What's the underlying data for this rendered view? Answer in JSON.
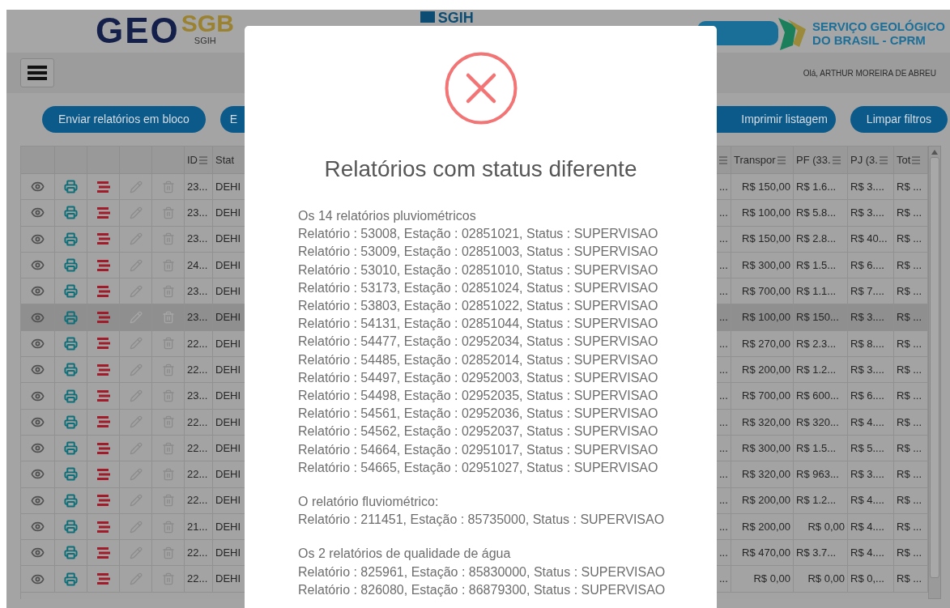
{
  "header": {
    "logo_left": {
      "word": "GEO",
      "brand": "SGB",
      "system": "SGIH"
    },
    "logo_center": "SGIH",
    "agency": [
      "SERVIÇO GEOLÓGICO",
      "DO BRASIL - CPRM"
    ]
  },
  "nav": {
    "greeting": "Olá, ARTHUR MOREIRA DE ABREU"
  },
  "actions": [
    {
      "label": "Enviar relatórios em bloco"
    },
    {
      "label": "E"
    },
    {
      "label": "Imprimir listagem"
    },
    {
      "label": "Limpar filtros"
    }
  ],
  "table": {
    "columns": [
      "ID",
      "Stat",
      "Transpor",
      "PF (33.",
      "PJ (3.",
      "Tot"
    ],
    "rows": [
      {
        "id": "23...",
        "status": "DEHI",
        "column_8": "...",
        "transporte": "R$ 150,00",
        "pf": "R$ 1.6...",
        "pj": "R$ 3....",
        "total": "R$ ...",
        "selected": false
      },
      {
        "id": "23...",
        "status": "DEHI",
        "column_8": "...",
        "transporte": "R$ 100,00",
        "pf": "R$ 5.8...",
        "pj": "R$ 3....",
        "total": "R$ ...",
        "selected": false
      },
      {
        "id": "23...",
        "status": "DEHI",
        "column_8": "...",
        "transporte": "R$ 150,00",
        "pf": "R$ 2.8...",
        "pj": "R$ 40...",
        "total": "R$ ...",
        "selected": false
      },
      {
        "id": "24...",
        "status": "DEHI",
        "column_8": "...",
        "transporte": "R$ 300,00",
        "pf": "R$ 1.5...",
        "pj": "R$ 6....",
        "total": "R$ ...",
        "selected": false
      },
      {
        "id": "23...",
        "status": "DEHI",
        "column_8": "...",
        "transporte": "R$ 700,00",
        "pf": "R$ 1.1...",
        "pj": "R$ 7....",
        "total": "R$ ...",
        "selected": false
      },
      {
        "id": "23...",
        "status": "DEHI",
        "column_8": "...",
        "transporte": "R$ 100,00",
        "pf": "R$ 150...",
        "pj": "R$ 3....",
        "total": "R$ ...",
        "selected": true
      },
      {
        "id": "22...",
        "status": "DEHI",
        "column_8": "...",
        "transporte": "R$ 270,00",
        "pf": "R$ 2.3...",
        "pj": "R$ 8....",
        "total": "R$ ...",
        "selected": false
      },
      {
        "id": "22...",
        "status": "DEHI",
        "column_8": "...",
        "transporte": "R$ 200,00",
        "pf": "R$ 1.2...",
        "pj": "R$ 3....",
        "total": "R$ ...",
        "selected": false
      },
      {
        "id": "23...",
        "status": "DEHI",
        "column_8": "...",
        "transporte": "R$ 700,00",
        "pf": "R$ 600...",
        "pj": "R$ 6....",
        "total": "R$ ...",
        "selected": false
      },
      {
        "id": "22...",
        "status": "DEHI",
        "column_8": "...",
        "transporte": "R$ 320,00",
        "pf": "R$ 320...",
        "pj": "R$ 4....",
        "total": "R$ ...",
        "selected": false
      },
      {
        "id": "22...",
        "status": "DEHI",
        "column_8": "...",
        "transporte": "R$ 300,00",
        "pf": "R$ 1.5...",
        "pj": "R$ 5....",
        "total": "R$ ...",
        "selected": false
      },
      {
        "id": "22...",
        "status": "DEHI",
        "column_8": "...",
        "transporte": "R$ 320,00",
        "pf": "R$ 963...",
        "pj": "R$ 3....",
        "total": "R$ ...",
        "selected": false
      },
      {
        "id": "22...",
        "status": "DEHI",
        "column_8": "...",
        "transporte": "R$ 200,00",
        "pf": "R$ 1.2...",
        "pj": "R$ 4....",
        "total": "R$ ...",
        "selected": false
      },
      {
        "id": "21...",
        "status": "DEHI",
        "column_8": "...",
        "transporte": "R$ 200,00",
        "pf": "R$ 0,00",
        "pj": "R$ 4....",
        "total": "R$ ...",
        "selected": false
      },
      {
        "id": "22...",
        "status": "DEHI",
        "column_8": "...",
        "transporte": "R$ 470,00",
        "pf": "R$ 3.7...",
        "pj": "R$ 4....",
        "total": "R$ ...",
        "selected": false
      },
      {
        "id": "22...",
        "status": "DEHI",
        "column_8": "...",
        "transporte": "R$ 0,00",
        "pf": "R$ 0,00",
        "pj": "R$ 0,...",
        "total": "R$ ...",
        "selected": false
      }
    ]
  },
  "dialog": {
    "title": "Relatórios com status diferente",
    "groups": [
      {
        "heading": "Os 14 relatórios pluviométricos",
        "lines": [
          "Relatório : 53008, Estação : 02851021, Status : SUPERVISAO",
          "Relatório : 53009, Estação : 02851003, Status : SUPERVISAO",
          "Relatório : 53010, Estação : 02851010, Status : SUPERVISAO",
          "Relatório : 53173, Estação : 02851024, Status : SUPERVISAO",
          "Relatório : 53803, Estação : 02851022, Status : SUPERVISAO",
          "Relatório : 54131, Estação : 02851044, Status : SUPERVISAO",
          "Relatório : 54477, Estação : 02952034, Status : SUPERVISAO",
          "Relatório : 54485, Estação : 02852014, Status : SUPERVISAO",
          "Relatório : 54497, Estação : 02952003, Status : SUPERVISAO",
          "Relatório : 54498, Estação : 02952035, Status : SUPERVISAO",
          "Relatório : 54561, Estação : 02952036, Status : SUPERVISAO",
          "Relatório : 54562, Estação : 02952037, Status : SUPERVISAO",
          "Relatório : 54664, Estação : 02951017, Status : SUPERVISAO",
          "Relatório : 54665, Estação : 02951027, Status : SUPERVISAO"
        ]
      },
      {
        "heading": "O relatório fluviométrico:",
        "lines": [
          "Relatório : 211451, Estação : 85735000, Status : SUPERVISAO"
        ]
      },
      {
        "heading": "Os 2 relatórios de qualidade de água",
        "lines": [
          "Relatório : 825961, Estação : 85830000, Status : SUPERVISAO",
          "Relatório : 826080, Estação : 86879300, Status : SUPERVISAO"
        ]
      }
    ]
  }
}
